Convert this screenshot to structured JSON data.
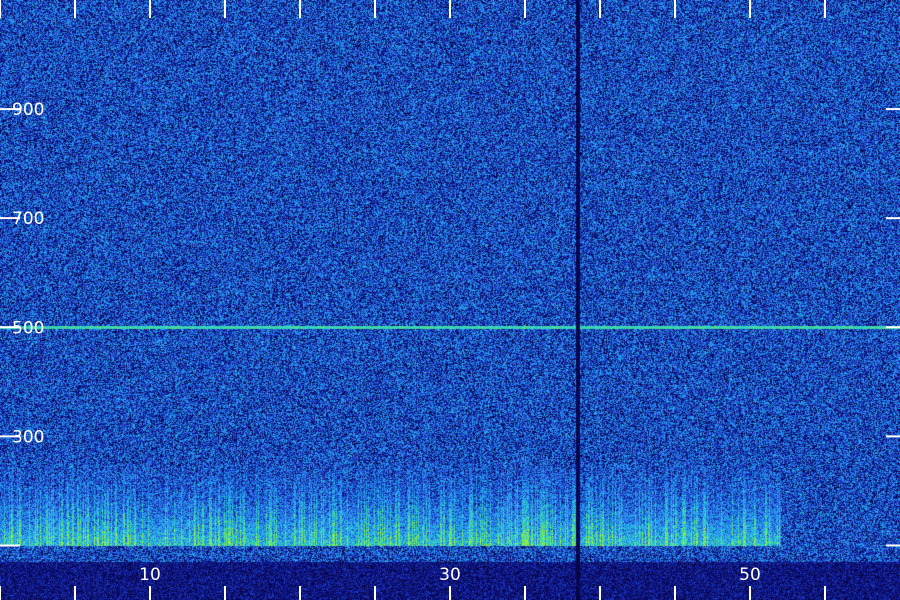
{
  "chart_data": {
    "type": "heatmap",
    "title": "",
    "xlabel": "",
    "ylabel": "",
    "xlim": [
      0,
      60
    ],
    "ylim": [
      0,
      1100
    ],
    "x_ticks": [
      0,
      5,
      10,
      15,
      20,
      25,
      30,
      35,
      40,
      45,
      50,
      55
    ],
    "x_tick_labels": [
      "10",
      "30",
      "50"
    ],
    "x_tick_label_values": [
      10,
      30,
      50
    ],
    "y_ticks": [
      100,
      300,
      500,
      700,
      900
    ],
    "y_tick_labels": [
      "300",
      "500",
      "700",
      "900"
    ],
    "y_tick_label_values": [
      300,
      500,
      700,
      900
    ],
    "colormap": [
      "#000000",
      "#0a0a6e",
      "#1e3cc8",
      "#2888f0",
      "#28c8e6",
      "#50e678",
      "#b4f028"
    ],
    "background_level": 0.35,
    "features": [
      {
        "kind": "horizontal-line",
        "y": 500,
        "level": 0.75
      },
      {
        "kind": "band",
        "y_range": [
          100,
          250
        ],
        "x_range": [
          0,
          52
        ],
        "level": 0.8
      },
      {
        "kind": "vertical-dropout",
        "x": 38.5,
        "level": 0.05
      },
      {
        "kind": "dark-floor",
        "y_range": [
          0,
          70
        ],
        "level": 0.1
      }
    ],
    "grid": false,
    "legend": "none"
  }
}
